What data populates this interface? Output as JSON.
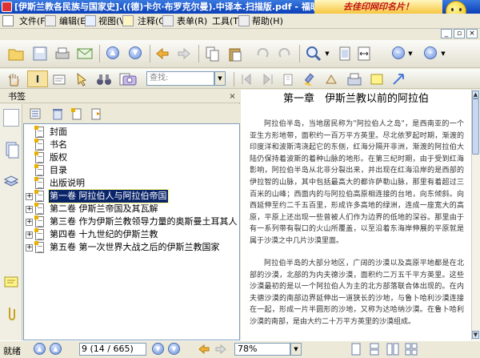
{
  "window": {
    "title": "[伊斯兰教各民族与国家史].((德)卡尔·布罗克尔曼).中译本.扫描版.pdf - 福昕阅读器 - [[伊..",
    "banner": "去佳印网印名片！"
  },
  "menu": [
    "文件(F)",
    "编辑(E)",
    "视图(V)",
    "注释(C)",
    "表单(R)",
    "工具(T)",
    "帮助(H)"
  ],
  "toolbar": {
    "search_placeholder": "查找:"
  },
  "icons": {
    "toolbar1": [
      "open-icon",
      "save-icon",
      "print-icon",
      "email-icon",
      "page-up-icon",
      "page-down-icon",
      "back-icon",
      "forward-icon",
      "copy-icon",
      "paste-icon",
      "undo-icon",
      "redo-icon",
      "zoom-icon",
      "zoom-dropdown-icon",
      "fit-page-icon",
      "fit-width-icon",
      "zoom-out-icon",
      "zoom-in-icon"
    ],
    "toolbar2": [
      "hand-icon",
      "text-select-icon",
      "snapshot-icon",
      "select-icon",
      "binoculars-icon",
      "find-icon",
      "camera-icon",
      "prev-result-icon",
      "next-result-icon",
      "bookmark-icon",
      "link-icon",
      "highlight-icon",
      "typewriter-icon",
      "arrow-icon"
    ]
  },
  "panel": {
    "title": "书签",
    "close": "×"
  },
  "bookmarks": [
    {
      "label": "封面",
      "expandable": false,
      "selected": false
    },
    {
      "label": "书名",
      "expandable": false,
      "selected": false
    },
    {
      "label": "版权",
      "expandable": false,
      "selected": false
    },
    {
      "label": "目录",
      "expandable": false,
      "selected": false
    },
    {
      "label": "出版说明",
      "expandable": false,
      "selected": false
    },
    {
      "label": "第一卷 阿拉伯人与阿拉伯帝国",
      "expandable": true,
      "selected": true
    },
    {
      "label": "第二卷 伊斯兰帝国及其瓦解",
      "expandable": true,
      "selected": false
    },
    {
      "label": "第三卷 作为伊斯兰教领导力量的奥斯曼土耳其人",
      "expandable": true,
      "selected": false
    },
    {
      "label": "第四卷 十九世纪的伊斯兰教",
      "expandable": true,
      "selected": false
    },
    {
      "label": "第五卷 第一次世界大战之后的伊斯兰教国家",
      "expandable": true,
      "selected": false
    }
  ],
  "document": {
    "chapter_title": "第一章　伊斯兰教以前的阿拉伯",
    "paragraph1": "阿拉伯半岛，当地居民称为\"阿拉伯人之岛\"，是西南亚的一个亚生方形地带，面积约一百万平方英里。尽北依罗起时期，渐渡的印度洋和波斯湾浇起它的东侧，红海分隔开非洲，渐渡的阿拉伯大陆仍保持着波斯的着种山脉的地形。在第三纪时期，由于受到红海影响，阿拉伯半岛从北非分裂出来，并出现在红海沿岸的是西部的伊拉智的山脉，其中包括最高大的都许萨勒山脉，那里有着超过三百米的山峰；西面内的与阿拉伯高原相连接的台地，向东倾斜。向西延伸至约二千五百里，形成许多高地的绿洲，连成一座宽大的高原，平原上还出现一些曾被人们作为边界的低地的深谷。那里由于有一系列带有裂口的火山所覆盖，以至沿着东海岸伸展的平原就是属于沙漠之中几片沙漠里面。",
    "paragraph2": "阿拉伯半岛的大部分地区，广阔的沙漠以及高原平地都是在北部的沙漠，北部的为内夫德沙漠，面积约二万五千平方英里。这些沙漠最初的是以一个阿拉伯人为主的北方部落联合体出现的。在内夫德沙漠的南部边界延伸出一道狭长的沙地，与鲁卜哈利沙漠连接在一起，形成一片半圆形的沙地，又称为达哈纳沙漠。在鲁卜哈利沙漠的南部，是由大约二十万平方英里的沙漠组成。"
  },
  "status": {
    "ready": "就绪",
    "page_value": "9",
    "page_info": "(14 / 665)",
    "zoom": "78%"
  }
}
